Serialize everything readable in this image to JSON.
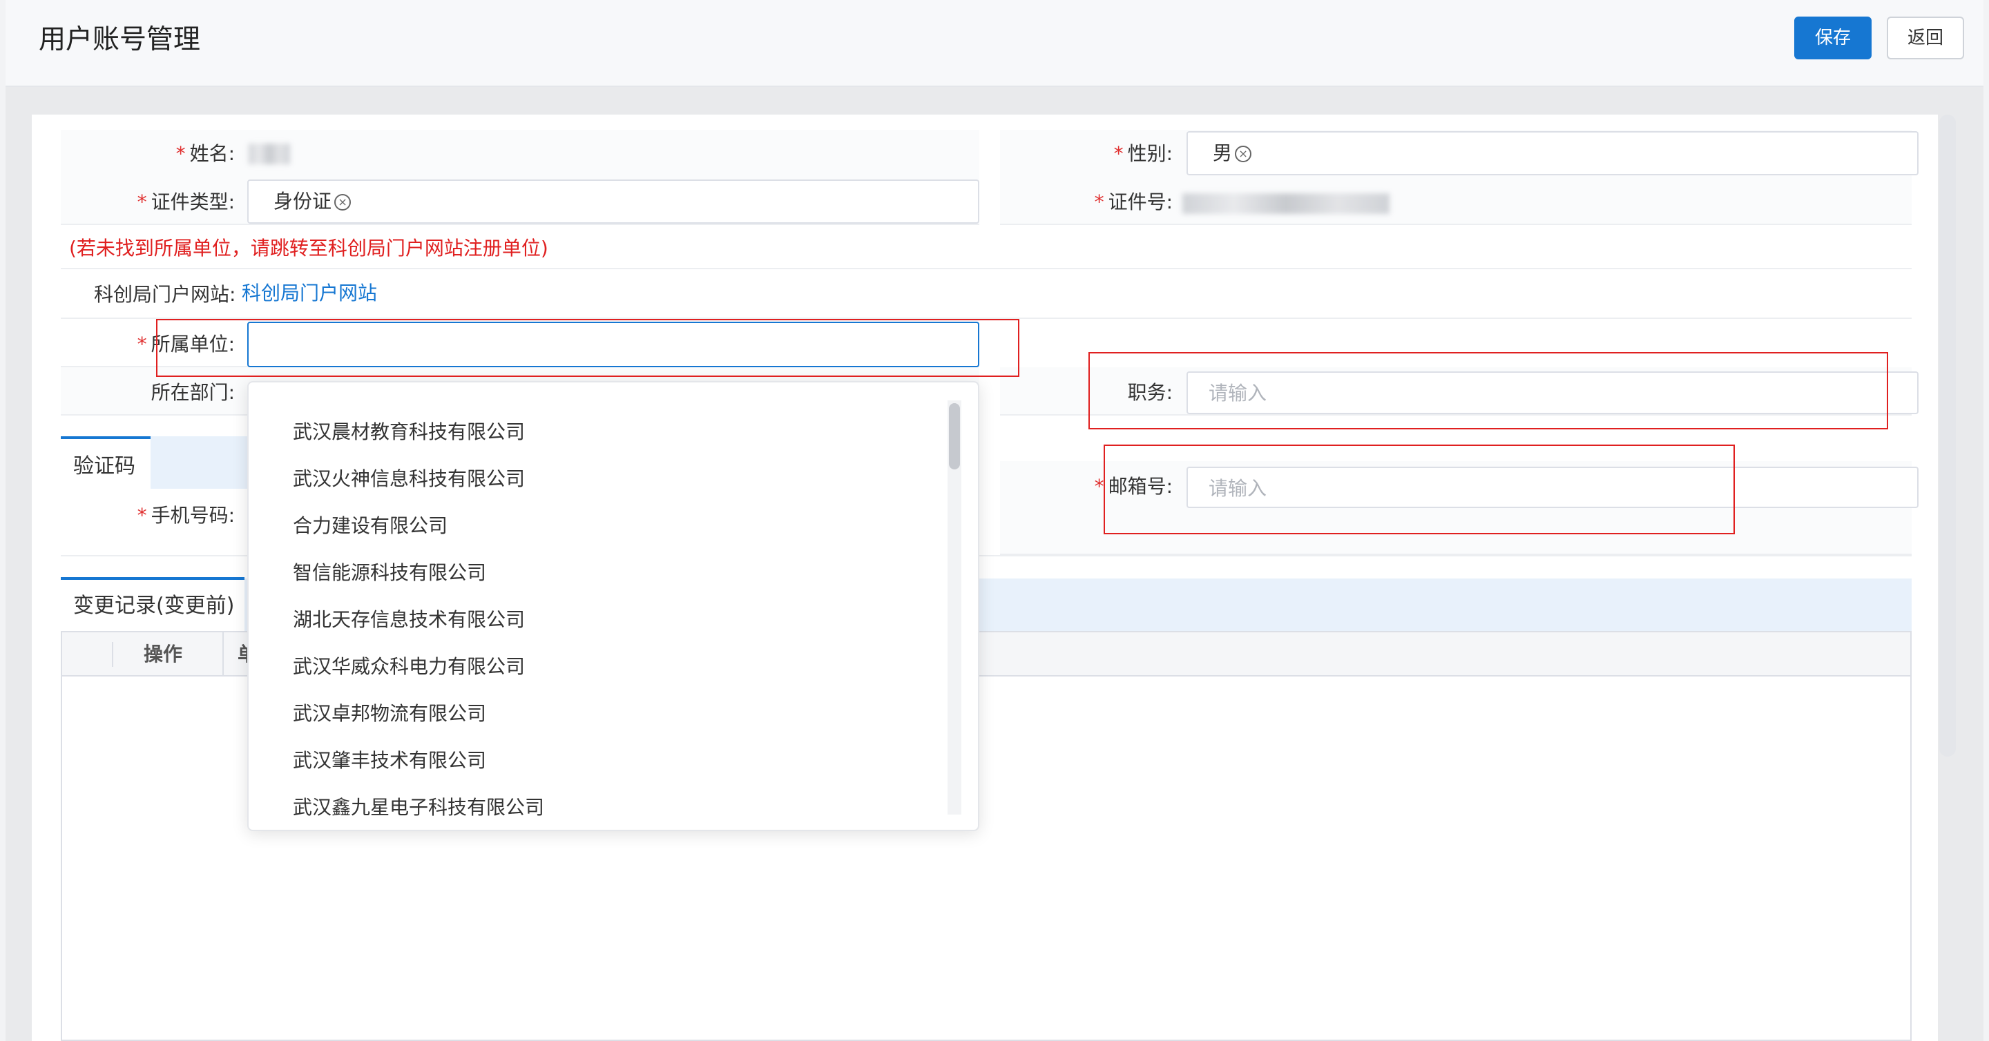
{
  "header": {
    "title": "用户账号管理",
    "save_label": "保存",
    "back_label": "返回"
  },
  "form": {
    "name_label": "姓名:",
    "gender_label": "性别:",
    "gender_value": "男",
    "id_type_label": "证件类型:",
    "id_type_value": "身份证",
    "id_no_label": "证件号:",
    "notice": "(若未找到所属单位，请跳转至科创局门户网站注册单位)",
    "portal_label": "科创局门户网站:",
    "portal_link": "科创局门户网站",
    "unit_label": "所属单位:",
    "dept_label": "所在部门:",
    "position_label": "职务:",
    "position_placeholder": "请输入",
    "email_label": "邮箱号:",
    "email_placeholder": "请输入",
    "phone_label": "手机号码:"
  },
  "tabs": {
    "verify": "验证码",
    "history": "变更记录(变更前)"
  },
  "table": {
    "headers": [
      "操作",
      "单"
    ]
  },
  "dropdown": {
    "options": [
      "武汉晨材教育科技有限公司",
      "武汉火神信息科技有限公司",
      "合力建设有限公司",
      "智信能源科技有限公司",
      "湖北天存信息技术有限公司",
      "武汉华威众科电力有限公司",
      "武汉卓邦物流有限公司",
      "武汉肇丰技术有限公司",
      "武汉鑫九星电子科技有限公司"
    ]
  },
  "colors": {
    "primary": "#1677d2",
    "required": "#e03030",
    "annotation": "#e02020"
  }
}
